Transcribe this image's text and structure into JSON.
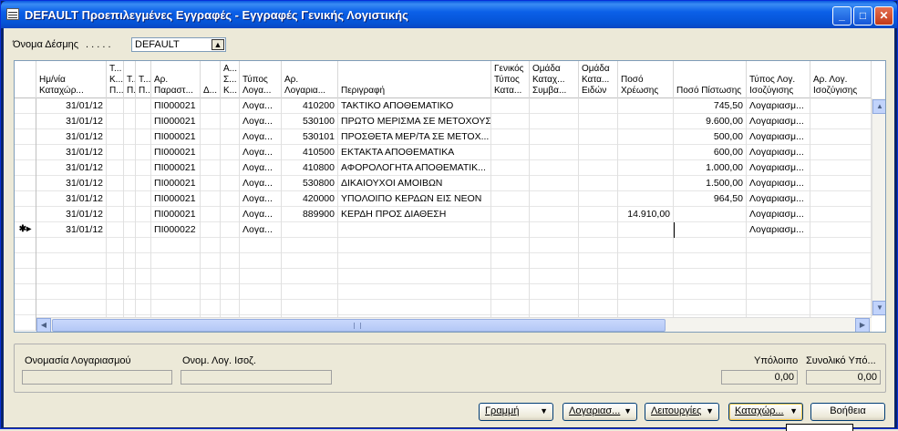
{
  "window": {
    "title": "DEFAULT Προεπιλεγμένες Εγγραφές - Εγγραφές Γενικής Λογιστικής",
    "min": "_",
    "max": "□",
    "close": "✕"
  },
  "batch": {
    "label": "Όνομα Δέσμης",
    "dots": ". . . . .",
    "value": "DEFAULT"
  },
  "columns": [
    {
      "key": "date",
      "label": "Ημ/νία\nΚαταχώρ..."
    },
    {
      "key": "c2",
      "label": "Τ...\nΚ...\nΠ..."
    },
    {
      "key": "c3",
      "label": "Τ...\nΠ..."
    },
    {
      "key": "c4",
      "label": "Τ...\nΠ..."
    },
    {
      "key": "doc",
      "label": "Αρ.\nΠαραστ..."
    },
    {
      "key": "c6",
      "label": "Δ..."
    },
    {
      "key": "c7",
      "label": "Α...\nΣ...\nΚ..."
    },
    {
      "key": "type",
      "label": "Τύπος\nΛογα..."
    },
    {
      "key": "acc",
      "label": "Αρ.\nΛογαρια..."
    },
    {
      "key": "desc",
      "label": "Περιγραφή"
    },
    {
      "key": "gen",
      "label": "Γενικός\nΤύπος\nΚατα..."
    },
    {
      "key": "grp1",
      "label": "Ομάδα\nΚαταχ...\nΣυμβα..."
    },
    {
      "key": "grp2",
      "label": "Ομάδα\nΚατα...\nΕιδών"
    },
    {
      "key": "debit",
      "label": "Ποσό\nΧρέωσης"
    },
    {
      "key": "credit",
      "label": "Ποσό Πίστωσης"
    },
    {
      "key": "baltype",
      "label": "Τύπος Λογ.\nΙσοζύγισης"
    },
    {
      "key": "balacc",
      "label": "Αρ. Λογ.\nΙσοζύγισης"
    }
  ],
  "rows": [
    {
      "date": "31/01/12",
      "doc": "ΠΙ000021",
      "type": "Λογα...",
      "acc": "410200",
      "desc": "ΤΑΚΤΙΚΟ ΑΠΟΘΕΜΑΤΙΚΟ",
      "debit": "",
      "credit": "745,50",
      "baltype": "Λογαριασμ..."
    },
    {
      "date": "31/01/12",
      "doc": "ΠΙ000021",
      "type": "Λογα...",
      "acc": "530100",
      "desc": "ΠΡΩΤΟ ΜΕΡΙΣΜΑ ΣΕ ΜΕΤΟΧΟΥΣ",
      "debit": "",
      "credit": "9.600,00",
      "baltype": "Λογαριασμ..."
    },
    {
      "date": "31/01/12",
      "doc": "ΠΙ000021",
      "type": "Λογα...",
      "acc": "530101",
      "desc": "ΠΡΟΣΘΕΤΑ ΜΕΡ/ΤΑ ΣΕ ΜΕΤΟΧ...",
      "debit": "",
      "credit": "500,00",
      "baltype": "Λογαριασμ..."
    },
    {
      "date": "31/01/12",
      "doc": "ΠΙ000021",
      "type": "Λογα...",
      "acc": "410500",
      "desc": "ΕΚΤΑΚΤΑ ΑΠΟΘΕΜΑΤΙΚΑ",
      "debit": "",
      "credit": "600,00",
      "baltype": "Λογαριασμ..."
    },
    {
      "date": "31/01/12",
      "doc": "ΠΙ000021",
      "type": "Λογα...",
      "acc": "410800",
      "desc": "ΑΦΟΡΟΛΟΓΗΤΑ ΑΠΟΘΕΜΑΤΙΚ...",
      "debit": "",
      "credit": "1.000,00",
      "baltype": "Λογαριασμ..."
    },
    {
      "date": "31/01/12",
      "doc": "ΠΙ000021",
      "type": "Λογα...",
      "acc": "530800",
      "desc": "ΔΙΚΑΙΟΥΧΟΙ ΑΜΟΙΒΩΝ",
      "debit": "",
      "credit": "1.500,00",
      "baltype": "Λογαριασμ..."
    },
    {
      "date": "31/01/12",
      "doc": "ΠΙ000021",
      "type": "Λογα...",
      "acc": "420000",
      "desc": "ΥΠΟΛΟΙΠΟ ΚΕΡΔΩΝ ΕΙΣ ΝΕΟΝ",
      "debit": "",
      "credit": "964,50",
      "baltype": "Λογαριασμ..."
    },
    {
      "date": "31/01/12",
      "doc": "ΠΙ000021",
      "type": "Λογα...",
      "acc": "889900",
      "desc": "ΚΕΡΔΗ ΠΡΟΣ ΔΙΑΘΕΣΗ",
      "debit": "14.910,00",
      "credit": "",
      "baltype": "Λογαριασμ..."
    },
    {
      "date": "31/01/12",
      "doc": "ΠΙ000022",
      "type": "Λογα...",
      "acc": "",
      "desc": "",
      "debit": "",
      "credit": "",
      "baltype": "Λογαριασμ...",
      "new": "✱▸"
    }
  ],
  "empty_rows": 6,
  "info": {
    "acc_name_label": "Ονομασία Λογαριασμού",
    "bal_acc_name_label": "Ονομ. Λογ. Ισοζ.",
    "balance_label": "Υπόλοιπο",
    "total_balance_label": "Συνολικό Υπό...",
    "balance_value": "0,00",
    "total_balance_value": "0,00"
  },
  "buttons": {
    "line": "Γραμμή",
    "account": "Λογαριασ...",
    "functions": "Λειτουργίες",
    "posting": "Καταχώρ...",
    "help": "Βοήθεια"
  },
  "colors": {
    "title_blue": "#0b60e8",
    "face": "#ece9d8"
  }
}
